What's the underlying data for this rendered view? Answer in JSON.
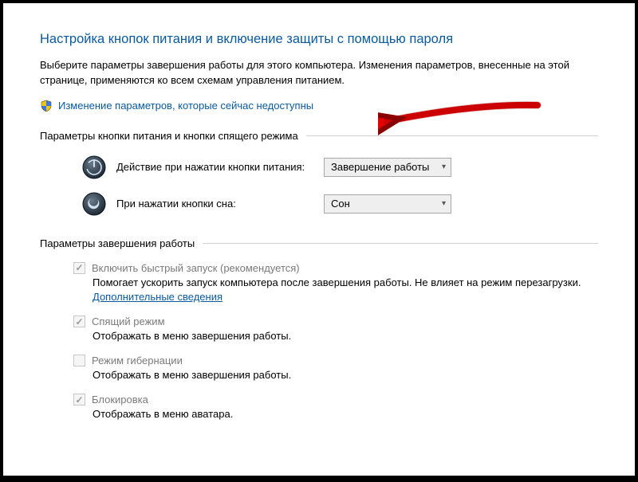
{
  "title": "Настройка кнопок питания и включение защиты с помощью пароля",
  "intro": "Выберите параметры завершения работы для этого компьютера. Изменения параметров, внесенные на этой странице, применяются ко всем схемам управления питанием.",
  "uac_link": "Изменение параметров, которые сейчас недоступны",
  "section_buttons": "Параметры кнопки питания и кнопки спящего режима",
  "power_button": {
    "label": "Действие при нажатии кнопки питания:",
    "value": "Завершение работы"
  },
  "sleep_button": {
    "label": "При нажатии кнопки сна:",
    "value": "Сон"
  },
  "section_shutdown": "Параметры завершения работы",
  "opts": {
    "fastboot": {
      "title": "Включить быстрый запуск (рекомендуется)",
      "desc_a": "Помогает ускорить запуск компьютера после завершения работы. Не влияет на режим перезагрузки. ",
      "more": "Дополнительные сведения"
    },
    "sleep": {
      "title": "Спящий режим",
      "desc": "Отображать в меню завершения работы."
    },
    "hibernate": {
      "title": "Режим гибернации",
      "desc": "Отображать в меню завершения работы."
    },
    "lock": {
      "title": "Блокировка",
      "desc": "Отображать в меню аватара."
    }
  }
}
